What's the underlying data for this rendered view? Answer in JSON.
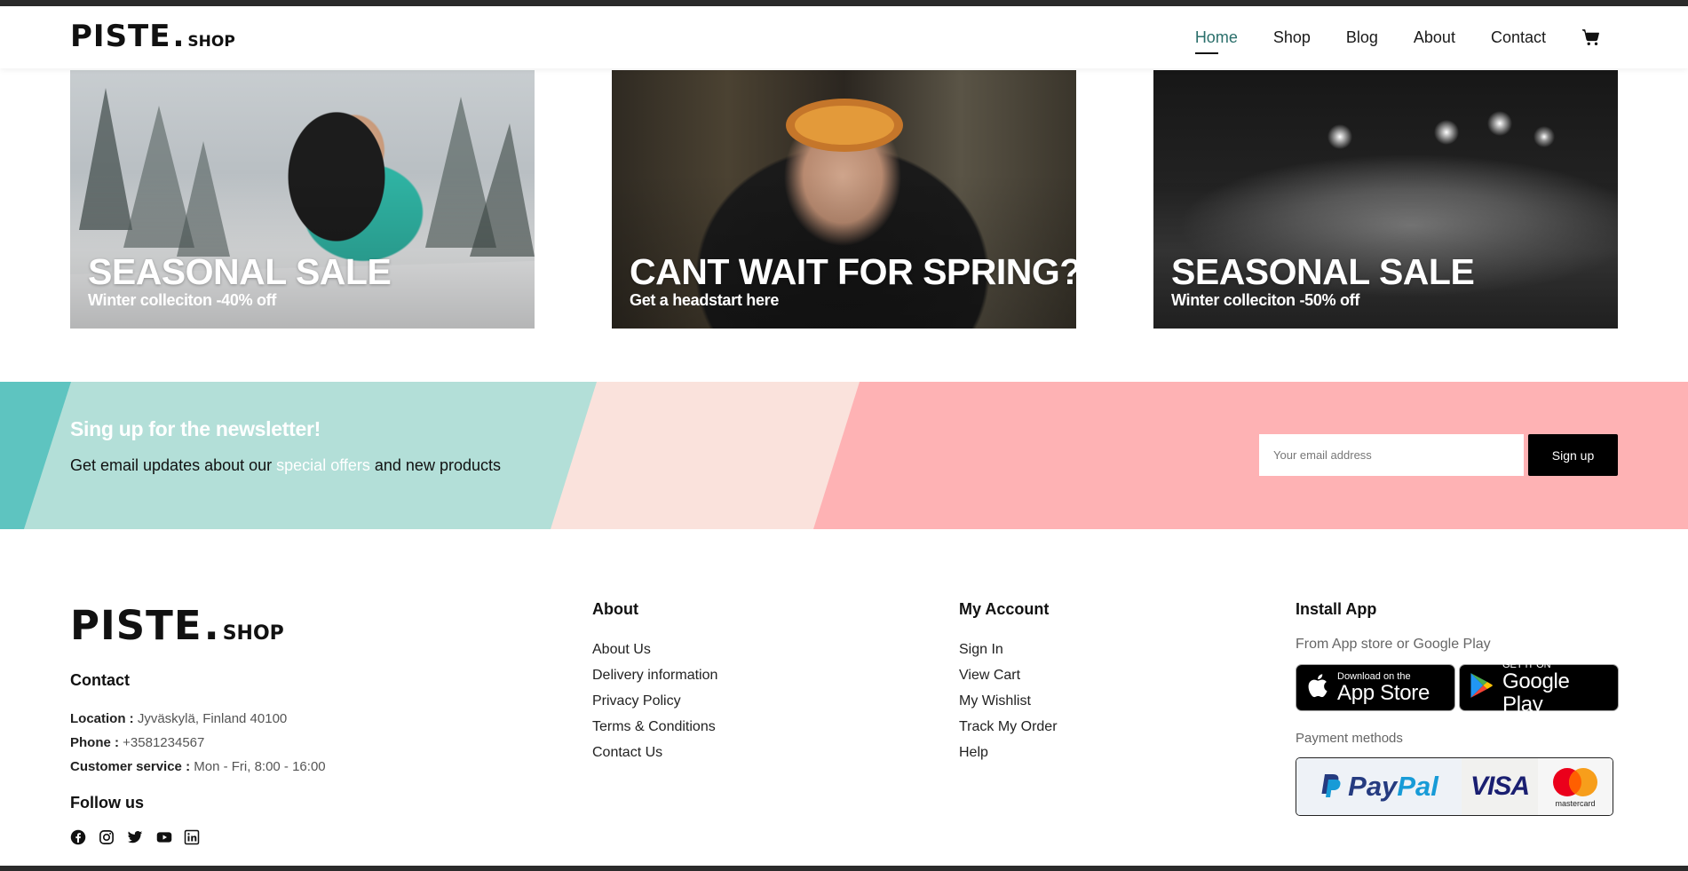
{
  "brand": {
    "name": "PISTE",
    "dot": ".",
    "suffix": "SHOP"
  },
  "nav": {
    "items": [
      {
        "label": "Home",
        "active": true
      },
      {
        "label": "Shop",
        "active": false
      },
      {
        "label": "Blog",
        "active": false
      },
      {
        "label": "About",
        "active": false
      },
      {
        "label": "Contact",
        "active": false
      }
    ],
    "cart_icon": "shopping-cart-icon"
  },
  "banners": [
    {
      "title": "SEASONAL SALE",
      "subtitle": "Winter colleciton -40% off"
    },
    {
      "title": "CANT WAIT FOR SPRING?",
      "subtitle": "Get a headstart here"
    },
    {
      "title": "SEASONAL SALE",
      "subtitle": "Winter colleciton -50% off"
    }
  ],
  "newsletter": {
    "title": "Sing up for the newsletter!",
    "text_before": "Get email updates about our ",
    "highlight": "special offers",
    "text_after": " and new products",
    "input_placeholder": "Your email address",
    "button_label": "Sign up",
    "colors": {
      "background": "#feb2b4",
      "teal": "#5ec4c0",
      "mint": "#b3dfd8",
      "blush": "#fae2dc"
    }
  },
  "footer": {
    "contact": {
      "heading": "Contact",
      "location_label": "Location :",
      "location_value": " Jyväskylä, Finland 40100",
      "phone_label": "Phone :",
      "phone_value": " +3581234567",
      "service_label": "Customer service :",
      "service_value": " Mon - Fri, 8:00 - 16:00"
    },
    "follow": {
      "heading": "Follow us",
      "icons": [
        "facebook-icon",
        "instagram-icon",
        "twitter-icon",
        "youtube-icon",
        "linkedin-icon"
      ]
    },
    "about": {
      "heading": "About",
      "links": [
        "About Us",
        "Delivery information",
        "Privacy Policy",
        "Terms & Conditions",
        "Contact Us"
      ]
    },
    "account": {
      "heading": "My Account",
      "links": [
        "Sign In",
        "View Cart",
        "My Wishlist",
        "Track My Order",
        "Help"
      ]
    },
    "install": {
      "heading": "Install App",
      "subtitle": "From App store or Google Play",
      "app_store": {
        "small": "Download on the",
        "big": "App Store"
      },
      "google_play": {
        "small": "GET IT ON",
        "big": "Google Play"
      },
      "payment_label": "Payment methods",
      "payment": {
        "paypal_a": "Pay",
        "paypal_b": "Pal",
        "visa": "VISA",
        "mastercard": "mastercard"
      }
    }
  }
}
